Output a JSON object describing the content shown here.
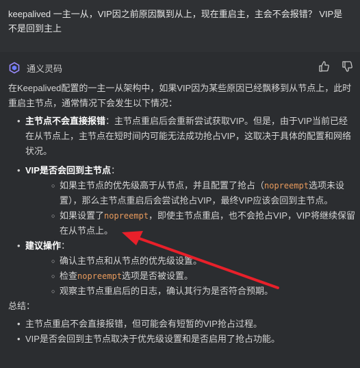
{
  "question": {
    "text": "keepalived 一主一从，VIP因之前原因飘到从上，现在重启主，主会不会报错？ VIP是不是回到主上"
  },
  "assistant": {
    "name": "通义灵码",
    "logo_icon": "tongyi-logo-icon",
    "actions": [
      "thumbs-up-icon",
      "thumbs-down-icon"
    ]
  },
  "answer": {
    "intro": "在Keepalived配置的一主一从架构中，如果VIP因为某些原因已经飘移到从节点上，此时重启主节点，通常情况下会发生以下情况：",
    "points": {
      "p1": {
        "title": "主节点不会直接报错",
        "sep": "：",
        "text": "主节点重启后会重新尝试获取VIP。但是，由于VIP当前已经在从节点上，主节点在短时间内可能无法成功抢占VIP，这取决于具体的配置和网络状况。"
      },
      "p2": {
        "title": "VIP是否会回到主节点",
        "sep": "：",
        "sub1": {
          "a": "如果主节点的优先级高于从节点，并且配置了抢占（",
          "code": "nopreempt",
          "b": "选项未设置），那么主节点重启后会尝试抢占VIP，最终VIP应该会回到主节点。"
        },
        "sub2": {
          "a": "如果设置了",
          "code": "nopreempt",
          "b": "，即使主节点重启，也不会抢占VIP，VIP将继续保留在从节点上。"
        }
      },
      "p3": {
        "title": "建议操作",
        "sep": "：",
        "sub1": "确认主节点和从节点的优先级设置。",
        "sub2": {
          "a": "检查",
          "code": "nopreempt",
          "b": "选项是否被设置。"
        },
        "sub3": "观察主节点重启后的日志，确认其行为是否符合预期。"
      }
    },
    "summary_label": "总结：",
    "summary": [
      "主节点重启不会直接报错，但可能会有短暂的VIP抢占过程。",
      "VIP是否会回到主节点取决于优先级设置和是否启用了抢占功能。"
    ]
  },
  "colors": {
    "code": "#e89a5c",
    "arrow": "#e8202a",
    "background": "#2b2d30"
  }
}
